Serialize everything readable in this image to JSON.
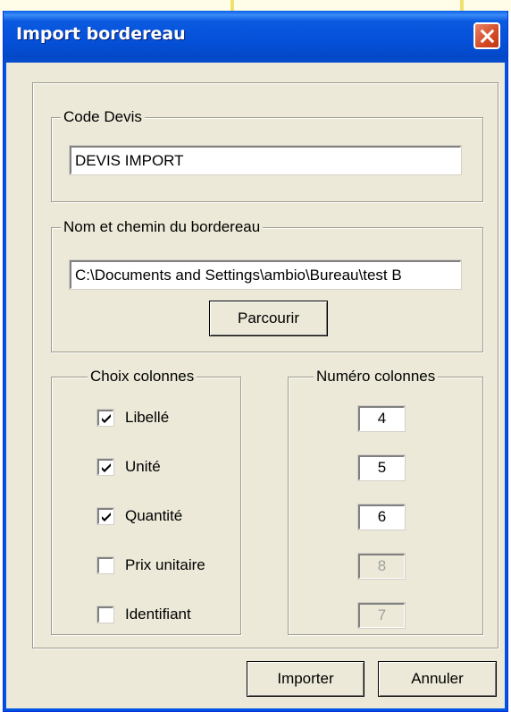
{
  "window": {
    "title": "Import bordereau"
  },
  "code_devis": {
    "legend": "Code Devis",
    "value": "DEVIS IMPORT"
  },
  "bordereau": {
    "legend": "Nom et chemin du bordereau",
    "path_value": "C:\\Documents and Settings\\ambio\\Bureau\\test B",
    "browse_label": "Parcourir"
  },
  "choix_colonnes": {
    "legend": "Choix colonnes",
    "items": [
      {
        "label": "Libellé",
        "checked": true
      },
      {
        "label": "Unité",
        "checked": true
      },
      {
        "label": "Quantité",
        "checked": true
      },
      {
        "label": "Prix unitaire",
        "checked": false
      },
      {
        "label": "Identifiant",
        "checked": false
      }
    ]
  },
  "numero_colonnes": {
    "legend": "Numéro colonnes",
    "values": [
      "4",
      "5",
      "6",
      "8",
      "7"
    ],
    "enabled": [
      true,
      true,
      true,
      false,
      false
    ]
  },
  "buttons": {
    "import_label": "Importer",
    "cancel_label": "Annuler"
  },
  "colors": {
    "titlebar": "#0550d8",
    "dialog_bg": "#ece9d8",
    "close_button": "#d44a25"
  }
}
